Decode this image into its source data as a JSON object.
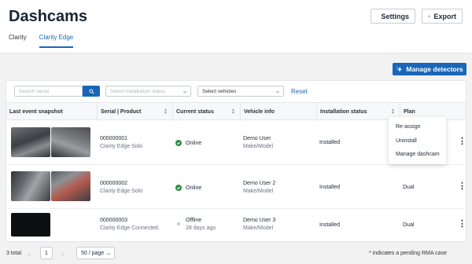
{
  "header": {
    "title": "Dashcams",
    "settings_label": "Settings",
    "export_label": "Export",
    "tabs": [
      {
        "label": "Clarity",
        "active": false
      },
      {
        "label": "Clarity Edge",
        "active": true
      }
    ]
  },
  "actions": {
    "manage_detectors_label": "Manage detectors"
  },
  "filters": {
    "search_placeholder": "Search serial",
    "installation_status_placeholder": "Select installation status",
    "vehicles_value": "Select vehicles",
    "reset_label": "Reset"
  },
  "table": {
    "columns": [
      "Last event snapshot",
      "Serial  |  Product",
      "Current status",
      "Vehicle info",
      "Installation status",
      "Plan"
    ],
    "rows": [
      {
        "serial": "000000001",
        "product": "Clarity Edge Solo",
        "status": "Online",
        "status_detail": "",
        "vehicle": "Demo User",
        "model": "Make/Model",
        "installation": "Installed",
        "plan": ""
      },
      {
        "serial": "000000002",
        "product": "Clarity Edge Solo",
        "status": "Online",
        "status_detail": "",
        "vehicle": "Demo User 2",
        "model": "Make/Model",
        "installation": "Installed",
        "plan": "Dual"
      },
      {
        "serial": "000000003",
        "product": "Clarity Edge Connected",
        "status": "Offline",
        "status_detail": "28 days ago",
        "vehicle": "Demo User 3",
        "model": "Make/Model",
        "installation": "Installed",
        "plan": "Dual"
      }
    ]
  },
  "row_menu": {
    "items": [
      "Re-assign",
      "Uninstall",
      "Manage dashcam"
    ]
  },
  "pagination": {
    "total": "3 total",
    "current_page": "1",
    "page_size": "50 / page"
  },
  "footnote": "* indicates a pending RMA case",
  "colors": {
    "accent": "#1a66b8",
    "online": "#2e8a3f",
    "offline": "#c6cbd1"
  }
}
